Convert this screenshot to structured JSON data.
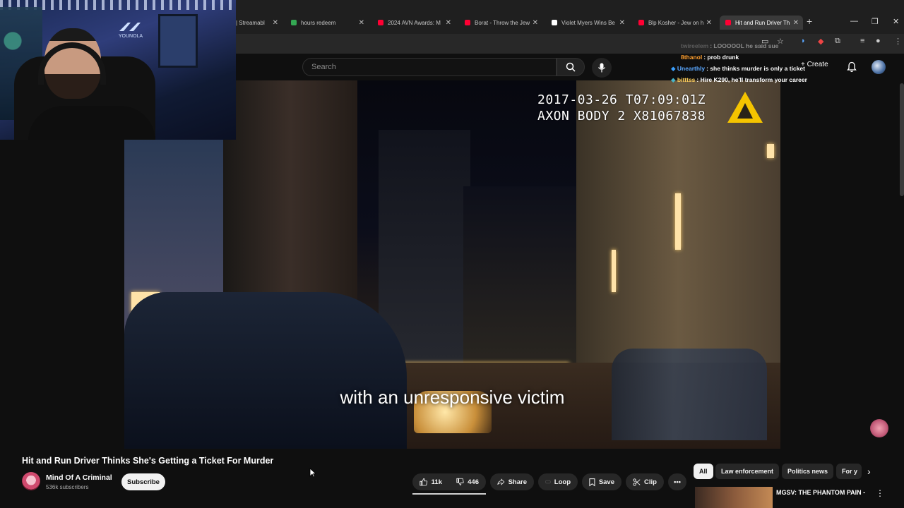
{
  "browser": {
    "tabs": [
      {
        "title": "| Streamabl",
        "color": "#2a7ed8"
      },
      {
        "title": "hours redeem",
        "color": "#34a853"
      },
      {
        "title": "2024 AVN Awards: M",
        "color": "#ff0033"
      },
      {
        "title": "Borat - Throw the Jew",
        "color": "#ff0033"
      },
      {
        "title": "Violet Myers Wins Be",
        "color": "#ffffff"
      },
      {
        "title": "Blp Kosher - Jew on h",
        "color": "#ff0033"
      },
      {
        "title": "Hit and Run Driver Th",
        "color": "#ff0033"
      }
    ],
    "close_glyph": "✕",
    "new_tab": "+"
  },
  "youtube": {
    "search_placeholder": "Search",
    "create_label": "Create",
    "video_title": "Hit and Run Driver Thinks She's Getting a Ticket For Murder",
    "channel_name": "Mind Of A Criminal",
    "subscribers": "536k subscribers",
    "subscribe_label": "Subscribe",
    "like_count": "11k",
    "dislike_count": "446",
    "share_label": "Share",
    "loop_label": "Loop",
    "save_label": "Save",
    "clip_label": "Clip",
    "chips": [
      "All",
      "Law enforcement",
      "Politics news",
      "For y"
    ],
    "reco_title": "MGSV: THE PHANTOM PAIN -"
  },
  "video": {
    "timestamp_line1": "2017-03-26 T07:09:01Z",
    "timestamp_line2": "AXON BODY 2 X81067838",
    "caption": "with an unresponsive victim"
  },
  "chat": [
    {
      "user": "twireelem",
      "text": ": LOOOOOL he said sue",
      "user_color": "#9a9a9a",
      "faded": true
    },
    {
      "user": "8thanol",
      "text": ": prob drunk",
      "user_color": "#ff9f2e",
      "faded": false
    },
    {
      "user": "Unearthly",
      "text": ": she thinks murder is only a ticket",
      "user_color": "#5aa7ff",
      "faded": false
    },
    {
      "user": "bitttss",
      "text": ": Hire K290, he'll transform your career",
      "user_color": "#ffcf5a",
      "faded": false
    }
  ],
  "webcam": {
    "logo_text": "YOUNOLA"
  }
}
